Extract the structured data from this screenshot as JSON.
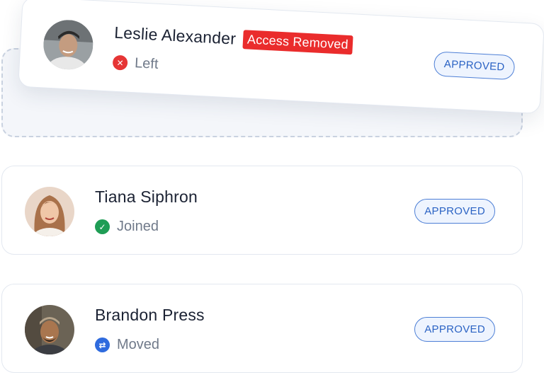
{
  "members": [
    {
      "name": "Leslie Alexander",
      "tag": "Access Removed",
      "status": "Left",
      "status_icon": "x-icon",
      "status_color": "#e63535",
      "badge": "APPROVED"
    },
    {
      "name": "Tiana Siphron",
      "status": "Joined",
      "status_icon": "check-icon",
      "status_color": "#1f9d55",
      "badge": "APPROVED"
    },
    {
      "name": "Brandon Press",
      "status": "Moved",
      "status_icon": "swap-icon",
      "status_color": "#2f6bde",
      "badge": "APPROVED"
    }
  ],
  "colors": {
    "tag_removed_bg": "#ea2c2c",
    "badge_border": "#4d7fd6",
    "badge_text": "#2b63c4",
    "card_border": "#e3e8f0"
  }
}
